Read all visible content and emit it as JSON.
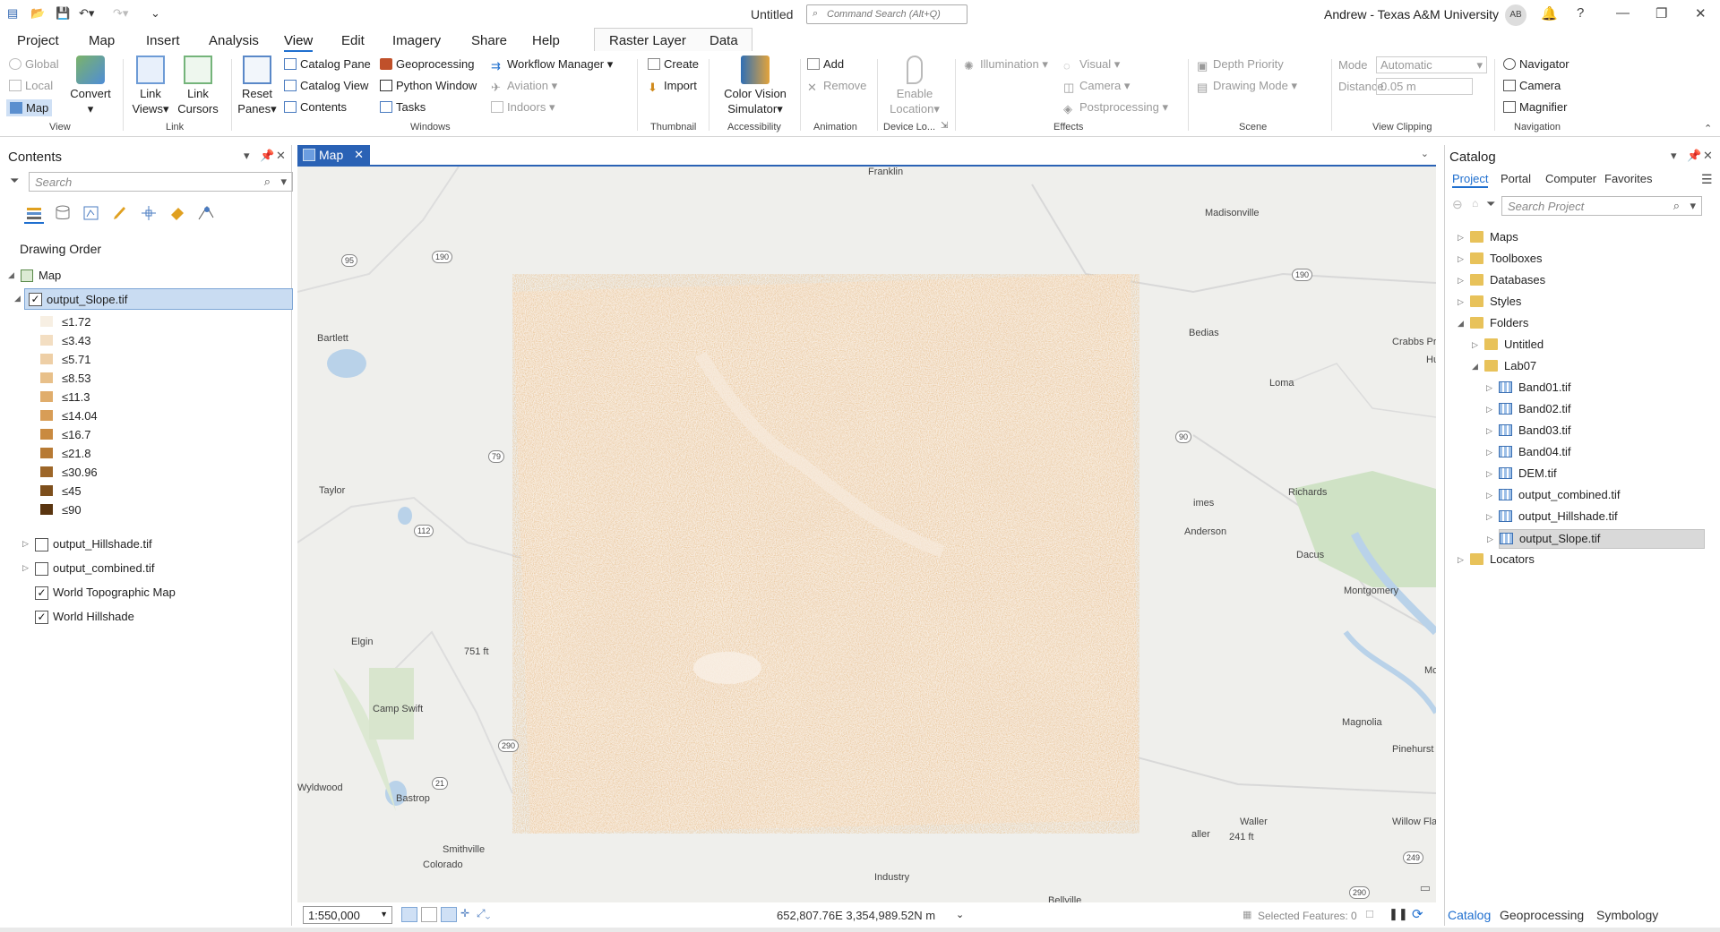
{
  "title_bar": {
    "document_title": "Untitled",
    "command_search_placeholder": "Command Search (Alt+Q)",
    "user": "Andrew - Texas A&M University",
    "avatar_initials": "AB"
  },
  "ribbon_tabs": [
    "Project",
    "Map",
    "Insert",
    "Analysis",
    "View",
    "Edit",
    "Imagery",
    "Share",
    "Help",
    "Raster Layer",
    "Data"
  ],
  "active_tab": "View",
  "ribbon": {
    "view_group": {
      "global": "Global",
      "local": "Local",
      "map": "Map",
      "convert": "Convert",
      "label": "View"
    },
    "link_group": {
      "link_views": "Link Views",
      "link_cursors": "Link Cursors",
      "label": "Link"
    },
    "windows_group": {
      "reset_panes": "Reset Panes",
      "catalog_pane": "Catalog Pane",
      "catalog_view": "Catalog View",
      "contents": "Contents",
      "geoprocessing": "Geoprocessing",
      "python_window": "Python Window",
      "tasks": "Tasks",
      "workflow_manager": "Workflow Manager",
      "aviation": "Aviation",
      "indoors": "Indoors",
      "label": "Windows"
    },
    "thumbnail_group": {
      "create": "Create",
      "import": "Import",
      "label": "Thumbnail"
    },
    "accessibility_group": {
      "color_vision": "Color Vision Simulator",
      "label": "Accessibility"
    },
    "animation_group": {
      "add": "Add",
      "remove": "Remove",
      "label": "Animation"
    },
    "device_group": {
      "enable_location": "Enable Location",
      "label": "Device Lo..."
    },
    "effects_group": {
      "illumination": "Illumination",
      "visual": "Visual",
      "camera": "Camera",
      "postprocessing": "Postprocessing",
      "label": "Effects"
    },
    "scene_group": {
      "depth_priority": "Depth Priority",
      "drawing_mode": "Drawing Mode",
      "label": "Scene"
    },
    "clipping_group": {
      "mode_label": "Mode",
      "mode_value": "Automatic",
      "distance_label": "Distance",
      "distance_value": "0.05  m",
      "label": "View Clipping"
    },
    "navigation_group": {
      "navigator": "Navigator",
      "camera": "Camera",
      "magnifier": "Magnifier",
      "label": "Navigation"
    }
  },
  "contents": {
    "title": "Contents",
    "search_placeholder": "Search",
    "drawing_order": "Drawing Order",
    "map_name": "Map",
    "selected_layer": "output_Slope.tif",
    "legend": [
      {
        "label": "≤1.72",
        "color": "#f7efe3"
      },
      {
        "label": "≤3.43",
        "color": "#f3dec2"
      },
      {
        "label": "≤5.71",
        "color": "#eecfa6"
      },
      {
        "label": "≤8.53",
        "color": "#e8c08a"
      },
      {
        "label": "≤11.3",
        "color": "#e0ad6c"
      },
      {
        "label": "≤14.04",
        "color": "#d89d56"
      },
      {
        "label": "≤16.7",
        "color": "#c98a40"
      },
      {
        "label": "≤21.8",
        "color": "#b77a34"
      },
      {
        "label": "≤30.96",
        "color": "#9d6628"
      },
      {
        "label": "≤45",
        "color": "#7d4f1c"
      },
      {
        "label": "≤90",
        "color": "#5a3510"
      }
    ],
    "layers": [
      {
        "name": "output_Hillshade.tif",
        "checked": false
      },
      {
        "name": "output_combined.tif",
        "checked": false
      },
      {
        "name": "World Topographic Map",
        "checked": true
      },
      {
        "name": "World Hillshade",
        "checked": true
      }
    ]
  },
  "map": {
    "tab_label": "Map",
    "scale": "1:550,000",
    "coordinates": "652,807.76E 3,354,989.52N m",
    "selected_features": "Selected Features: 0",
    "place_labels": [
      "Franklin",
      "Madisonville",
      "Bartlett",
      "Bedias",
      "Crabbs Prairie",
      "Hu",
      "Loma",
      "Taylor",
      "Richards",
      "Anderson",
      "Dacus",
      "Montgomery",
      "Elgin",
      "Camp Swift",
      "751 ft",
      "Magnolia",
      "Pinehurst",
      "Wyldwood",
      "Bastrop",
      "Waller",
      "Willow Flats",
      "Smithville",
      "Colorado",
      "Industry",
      "Bellville",
      "imes",
      "aller",
      "241 ft",
      "Mc"
    ],
    "road_shields": [
      "95",
      "190",
      "190",
      "79",
      "90",
      "112",
      "290",
      "21",
      "249",
      "290"
    ]
  },
  "catalog": {
    "title": "Catalog",
    "tabs": [
      "Project",
      "Portal",
      "Computer",
      "Favorites"
    ],
    "active_tab": "Project",
    "search_placeholder": "Search Project",
    "items": [
      {
        "label": "Maps",
        "level": 0,
        "type": "folder"
      },
      {
        "label": "Toolboxes",
        "level": 0,
        "type": "folder"
      },
      {
        "label": "Databases",
        "level": 0,
        "type": "folder"
      },
      {
        "label": "Styles",
        "level": 0,
        "type": "folder"
      },
      {
        "label": "Folders",
        "level": 0,
        "type": "folder"
      },
      {
        "label": "Untitled",
        "level": 1,
        "type": "folder"
      },
      {
        "label": "Lab07",
        "level": 1,
        "type": "folder"
      },
      {
        "label": "Band01.tif",
        "level": 2,
        "type": "raster"
      },
      {
        "label": "Band02.tif",
        "level": 2,
        "type": "raster"
      },
      {
        "label": "Band03.tif",
        "level": 2,
        "type": "raster"
      },
      {
        "label": "Band04.tif",
        "level": 2,
        "type": "raster"
      },
      {
        "label": "DEM.tif",
        "level": 2,
        "type": "raster"
      },
      {
        "label": "output_combined.tif",
        "level": 2,
        "type": "raster"
      },
      {
        "label": "output_Hillshade.tif",
        "level": 2,
        "type": "raster"
      },
      {
        "label": "output_Slope.tif",
        "level": 2,
        "type": "raster",
        "selected": true
      },
      {
        "label": "Locators",
        "level": 0,
        "type": "folder"
      }
    ],
    "bottom_tabs": [
      "Catalog",
      "Geoprocessing",
      "Symbology"
    ],
    "bottom_active": "Catalog"
  }
}
